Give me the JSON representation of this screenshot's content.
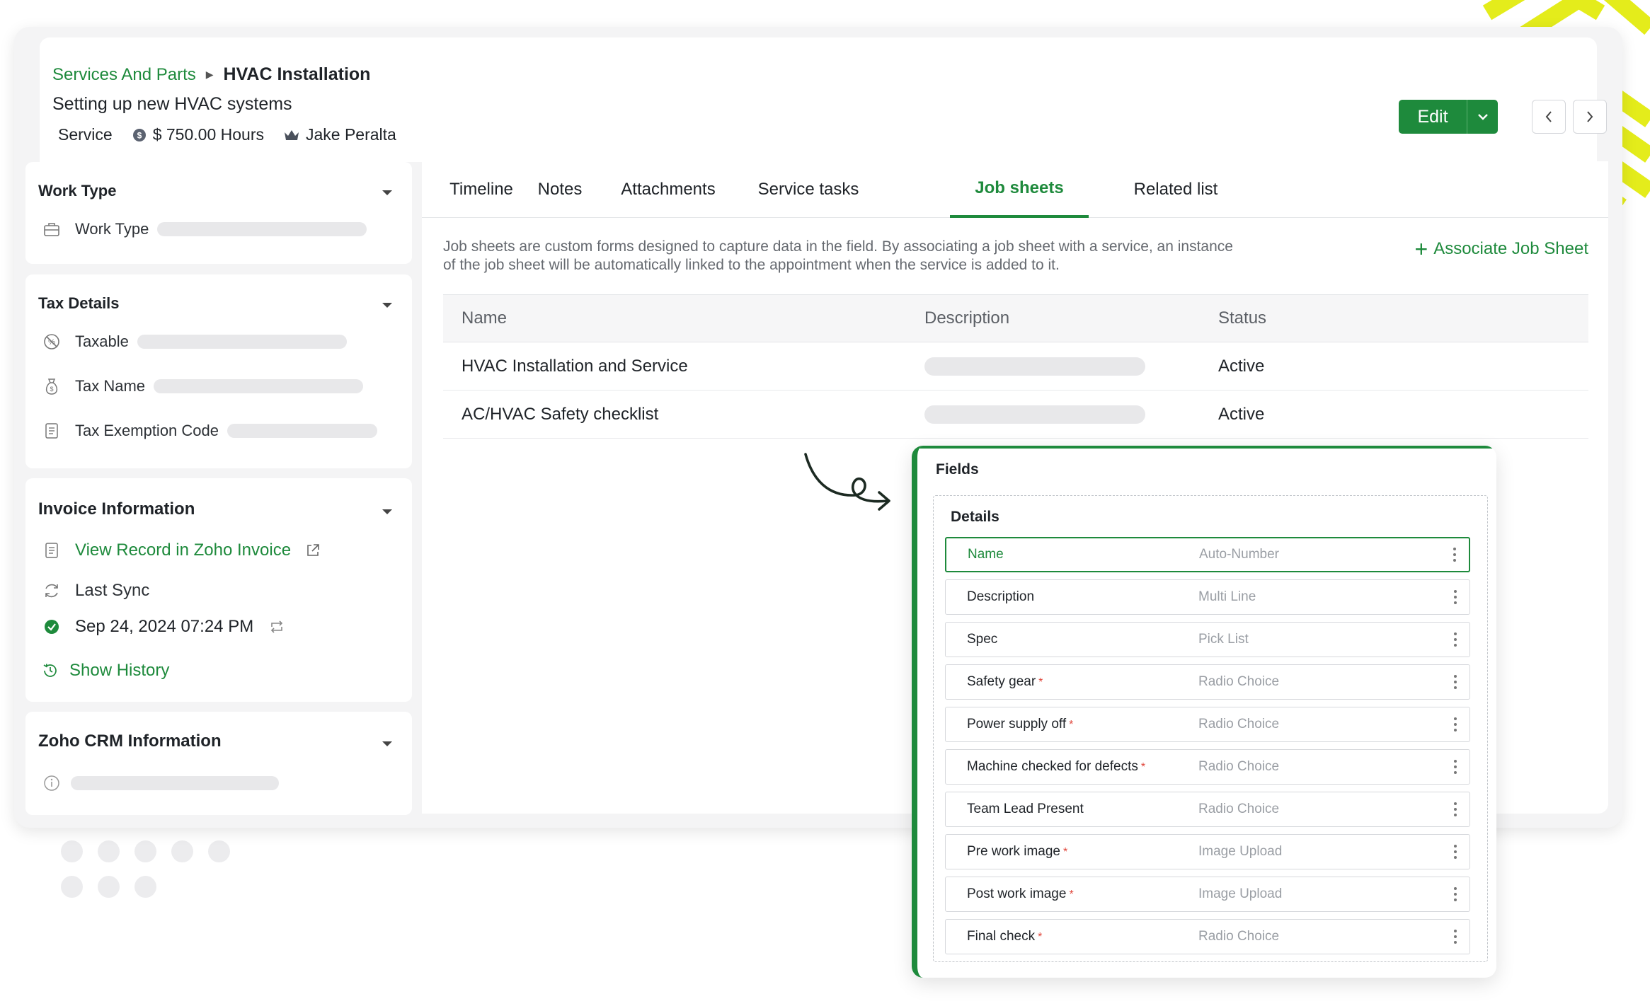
{
  "breadcrumb": {
    "parent": "Services And Parts",
    "current": "HVAC Installation"
  },
  "subtitle": "Setting up new HVAC systems",
  "meta": {
    "type": "Service",
    "price": "$ 750.00 Hours",
    "owner": "Jake Peralta"
  },
  "actions": {
    "edit_label": "Edit"
  },
  "left": {
    "work_type": {
      "title": "Work Type",
      "field_label": "Work Type"
    },
    "tax_details": {
      "title": "Tax Details",
      "fields": [
        "Taxable",
        "Tax Name",
        "Tax Exemption Code"
      ]
    },
    "invoice": {
      "title": "Invoice Information",
      "view_link": "View Record in Zoho Invoice",
      "last_sync_label": "Last Sync",
      "last_sync_value": "Sep 24, 2024 07:24 PM",
      "show_history": "Show History"
    },
    "crm": {
      "title": "Zoho CRM Information"
    }
  },
  "tabs": [
    "Timeline",
    "Notes",
    "Attachments",
    "Service tasks",
    "Job sheets",
    "Related list"
  ],
  "active_tab": "Job sheets",
  "jobsheets": {
    "description_line1": "Job sheets are custom forms designed to capture data in the field. By associating a job sheet with a service, an instance",
    "description_line2": "of the job sheet will be automatically linked to the appointment when the service is added to it.",
    "associate_label": "Associate Job Sheet",
    "columns": [
      "Name",
      "Description",
      "Status"
    ],
    "rows": [
      {
        "name": "HVAC Installation and Service",
        "status": "Active"
      },
      {
        "name": "AC/HVAC Safety checklist",
        "status": "Active"
      }
    ]
  },
  "fields_panel": {
    "title": "Fields",
    "section": "Details",
    "fields": [
      {
        "name": "Name",
        "type": "Auto-Number",
        "required": false
      },
      {
        "name": "Description",
        "type": "Multi Line",
        "required": false
      },
      {
        "name": "Spec",
        "type": "Pick List",
        "required": false
      },
      {
        "name": "Safety gear",
        "type": "Radio Choice",
        "required": true
      },
      {
        "name": "Power supply off",
        "type": "Radio Choice",
        "required": true
      },
      {
        "name": "Machine checked for defects",
        "type": "Radio Choice",
        "required": true
      },
      {
        "name": "Team Lead Present",
        "type": "Radio Choice",
        "required": false
      },
      {
        "name": "Pre work image",
        "type": "Image Upload",
        "required": true
      },
      {
        "name": "Post work image",
        "type": "Image Upload",
        "required": true
      },
      {
        "name": "Final check",
        "type": "Radio Choice",
        "required": true
      }
    ],
    "required_marker": "*"
  },
  "colors": {
    "accent": "#1e8a3c",
    "required": "#e0453a",
    "stripe": "#e4ec1b"
  },
  "icons": {
    "price": "dollar-coin-icon",
    "owner": "crown-icon",
    "work_type": "briefcase-icon",
    "taxable": "no-tax-icon",
    "tax_name": "money-bag-icon",
    "tax_exemption": "document-icon",
    "invoice": "invoice-icon",
    "external": "external-link-icon",
    "sync": "sync-icon",
    "success": "check-circle-icon",
    "resync": "repeat-icon",
    "history": "history-icon",
    "info": "info-icon",
    "more": "more-vertical-icon"
  }
}
